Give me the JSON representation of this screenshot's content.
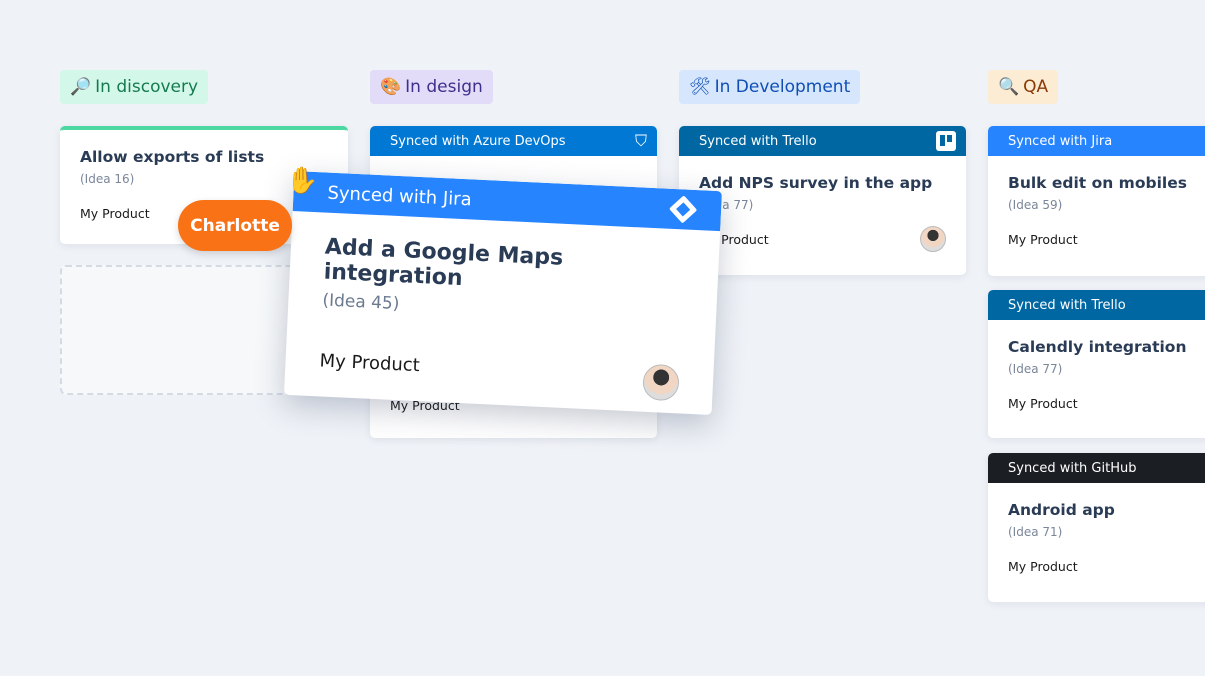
{
  "columns": [
    {
      "label": "In discovery",
      "icon": "magnifier-icon",
      "emoji": "🔎",
      "bg": "#d3f8ea",
      "color": "#167a4f"
    },
    {
      "label": "In design",
      "icon": "palette-icon",
      "emoji": "🎨",
      "bg": "#e2dcf8",
      "color": "#3f2f8a"
    },
    {
      "label": "In Development",
      "icon": "tools-icon",
      "emoji": "🛠",
      "bg": "#d6e6fd",
      "color": "#0f4fb5"
    },
    {
      "label": "QA",
      "icon": "magnifier-icon",
      "emoji": "🔍",
      "bg": "#fbecd3",
      "color": "#8a3a06"
    }
  ],
  "cards": {
    "discovery": {
      "title": "Allow exports of lists",
      "idea": "(Idea 16)",
      "product": "My Product"
    },
    "design": {
      "sync": "Synced with Azure DevOps",
      "product": "My Product"
    },
    "dev": {
      "sync": "Synced with Trello",
      "title": "Add NPS survey in the app",
      "idea": "(Idea 77)",
      "product": "My Product"
    },
    "qa1": {
      "sync": "Synced with Jira",
      "title": "Bulk edit on mobiles",
      "idea": "(Idea 59)",
      "product": "My Product"
    },
    "qa2": {
      "sync": "Synced with Trello",
      "title": "Calendly integration",
      "idea": "(Idea 77)",
      "product": "My Product"
    },
    "qa3": {
      "sync": "Synced with GitHub",
      "title": "Android app",
      "idea": "(Idea 71)",
      "product": "My Product"
    }
  },
  "dragged": {
    "sync": "Synced with Jira",
    "title": "Add a Google Maps integration",
    "idea": "(Idea 45)",
    "product": "My Product"
  },
  "cursor_user": "Charlotte",
  "colors": {
    "jira": "#2684ff",
    "azure": "#0078d4",
    "trello": "#0067a3",
    "github": "#1b1f23",
    "accent": "#f97316",
    "discovery": "#4cd8a0"
  }
}
